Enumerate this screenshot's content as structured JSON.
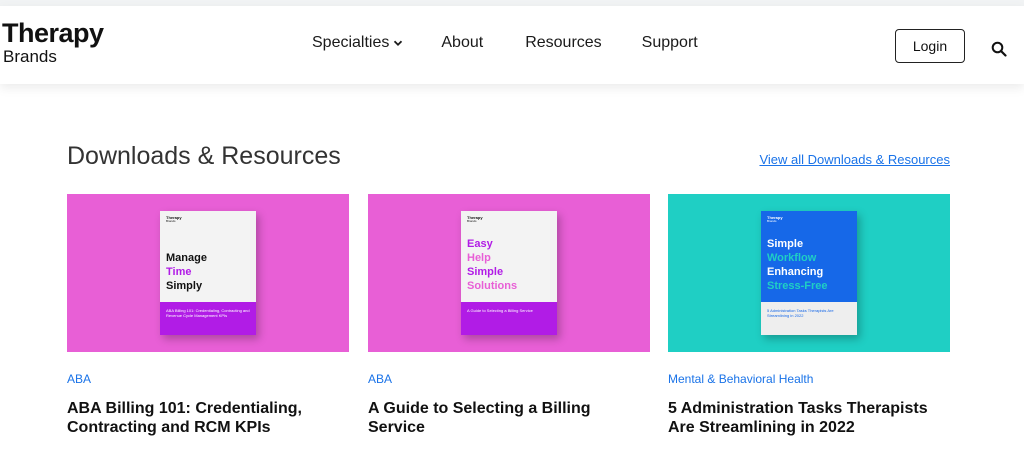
{
  "header": {
    "logo_line1": "Therapy",
    "logo_line2": "Brands",
    "nav": [
      {
        "label": "Specialties",
        "has_dropdown": true
      },
      {
        "label": "About"
      },
      {
        "label": "Resources"
      },
      {
        "label": "Support"
      }
    ],
    "login_label": "Login",
    "search_icon": "search-icon"
  },
  "section": {
    "title": "Downloads & Resources",
    "view_all": "View all Downloads & Resources"
  },
  "cards": [
    {
      "tag": "ABA",
      "title": "ABA Billing 101: Credentialing, Contracting and RCM KPIs",
      "bg": "#e85fd6",
      "band": "#b11ce6",
      "cover": {
        "brand": "Therapy",
        "brand_sub": "Brands",
        "lines": [
          {
            "text": "Manage",
            "color": "#111111"
          },
          {
            "text": "Time",
            "color": "#b11ce6"
          },
          {
            "text": "Simply",
            "color": "#111111"
          }
        ],
        "subtitle": "ABA Billing 101: Credentialing, Contracting and Revenue Cycle Management KPIs"
      }
    },
    {
      "tag": "ABA",
      "title": "A Guide to Selecting a Billing Service",
      "bg": "#e85fd6",
      "band": "#b11ce6",
      "cover": {
        "brand": "Therapy",
        "brand_sub": "Brands",
        "lines": [
          {
            "text": "Easy",
            "color": "#b11ce6"
          },
          {
            "text": "Help",
            "color": "#e85fd6"
          },
          {
            "text": "Simple",
            "color": "#b11ce6"
          },
          {
            "text": "Solutions",
            "color": "#e85fd6"
          }
        ],
        "subtitle": "A Guide to Selecting a Billing Service"
      }
    },
    {
      "tag": "Mental & Behavioral Health",
      "title": "5 Administration Tasks Therapists Are Streamlining in 2022",
      "bg": "#1fcfc4",
      "band": "#eeeeee",
      "cover": {
        "brand": "Therapy",
        "brand_sub": "Brands",
        "lines": [
          {
            "text": "Simple",
            "color": "#ffffff"
          },
          {
            "text": "Workflow",
            "color": "#1fcfc4"
          },
          {
            "text": "Enhancing",
            "color": "#ffffff"
          },
          {
            "text": "Stress-Free",
            "color": "#1fcfc4"
          }
        ],
        "subtitle": "5 Administration Tasks Therapists Are Streamlining in 2022"
      }
    }
  ]
}
